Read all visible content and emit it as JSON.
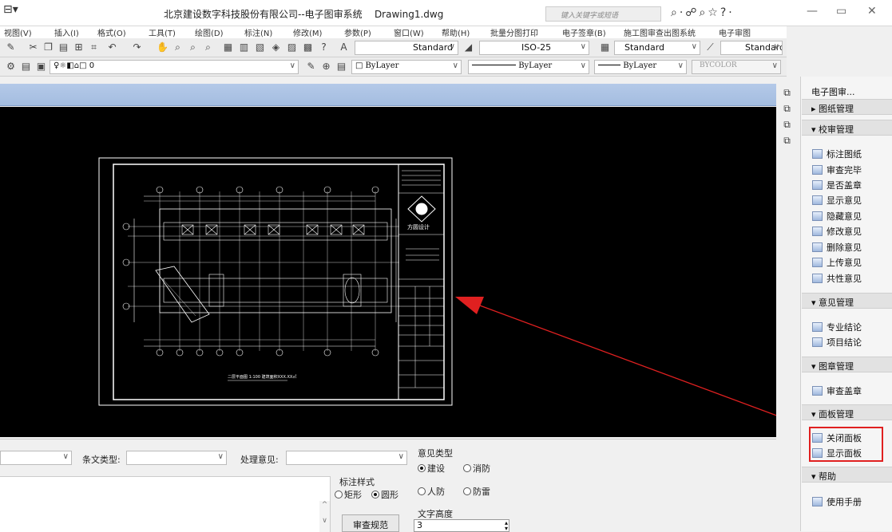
{
  "title_bar": {
    "title": "北京建设数字科技股份有限公司--电子图审系统",
    "filename": "Drawing1.dwg",
    "search_placeholder": "键入关键字或短语"
  },
  "menu": [
    "视图(V)",
    "插入(I)",
    "格式(O)",
    "工具(T)",
    "绘图(D)",
    "标注(N)",
    "修改(M)",
    "参数(P)",
    "窗口(W)",
    "帮助(H)",
    "批量分图打印",
    "电子签章(B)",
    "施工图审查出图系统",
    "电子审图"
  ],
  "toolbar": {
    "text_style": "Standard",
    "dim_style": "ISO-25",
    "table_style": "Standard",
    "multileader_style": "Standard",
    "layer": "0",
    "color": "ByLayer",
    "linetype": "ByLayer",
    "lineweight": "ByLayer",
    "plot_style": "BYCOLOR"
  },
  "drawing": {
    "plan_caption": "二层平面图 1:100 建筑面积XXX.XX㎡",
    "logo_text": "方圆设计"
  },
  "panel": {
    "title": "电子图审...",
    "sections": [
      {
        "label": "图纸管理",
        "expanded": false,
        "items": []
      },
      {
        "label": "校审管理",
        "expanded": true,
        "items": [
          "标注图纸",
          "审查完毕",
          "是否盖章",
          "显示意见",
          "隐藏意见",
          "修改意见",
          "删除意见",
          "上传意见",
          "共性意见"
        ]
      },
      {
        "label": "意见管理",
        "expanded": true,
        "items": [
          "专业结论",
          "项目结论"
        ]
      },
      {
        "label": "图章管理",
        "expanded": true,
        "items": [
          "审查盖章"
        ]
      },
      {
        "label": "面板管理",
        "expanded": true,
        "items": [
          "关闭面板",
          "显示面板"
        ]
      },
      {
        "label": "帮助",
        "expanded": true,
        "items": [
          "使用手册"
        ]
      }
    ]
  },
  "bottom": {
    "clause_type_label": "条文类型:",
    "handling_label": "处理意见:",
    "opinion_type_label": "意见类型",
    "opinion_types": [
      {
        "label": "建设",
        "checked": true
      },
      {
        "label": "消防",
        "checked": false
      },
      {
        "label": "人防",
        "checked": false
      },
      {
        "label": "防雷",
        "checked": false
      }
    ],
    "mark_style_label": "标注样式",
    "mark_styles": [
      {
        "label": "矩形",
        "checked": false
      },
      {
        "label": "圆形",
        "checked": true
      }
    ],
    "text_height_label": "文字高度",
    "text_height_value": "3",
    "review_button": "审查规范"
  },
  "colors": {
    "canvas": "#000000",
    "drawing_lines": "#ffffff",
    "arrow": "#e02020",
    "highlight": "#e02020",
    "dwg_tab_bar": "#a9c0e2"
  }
}
